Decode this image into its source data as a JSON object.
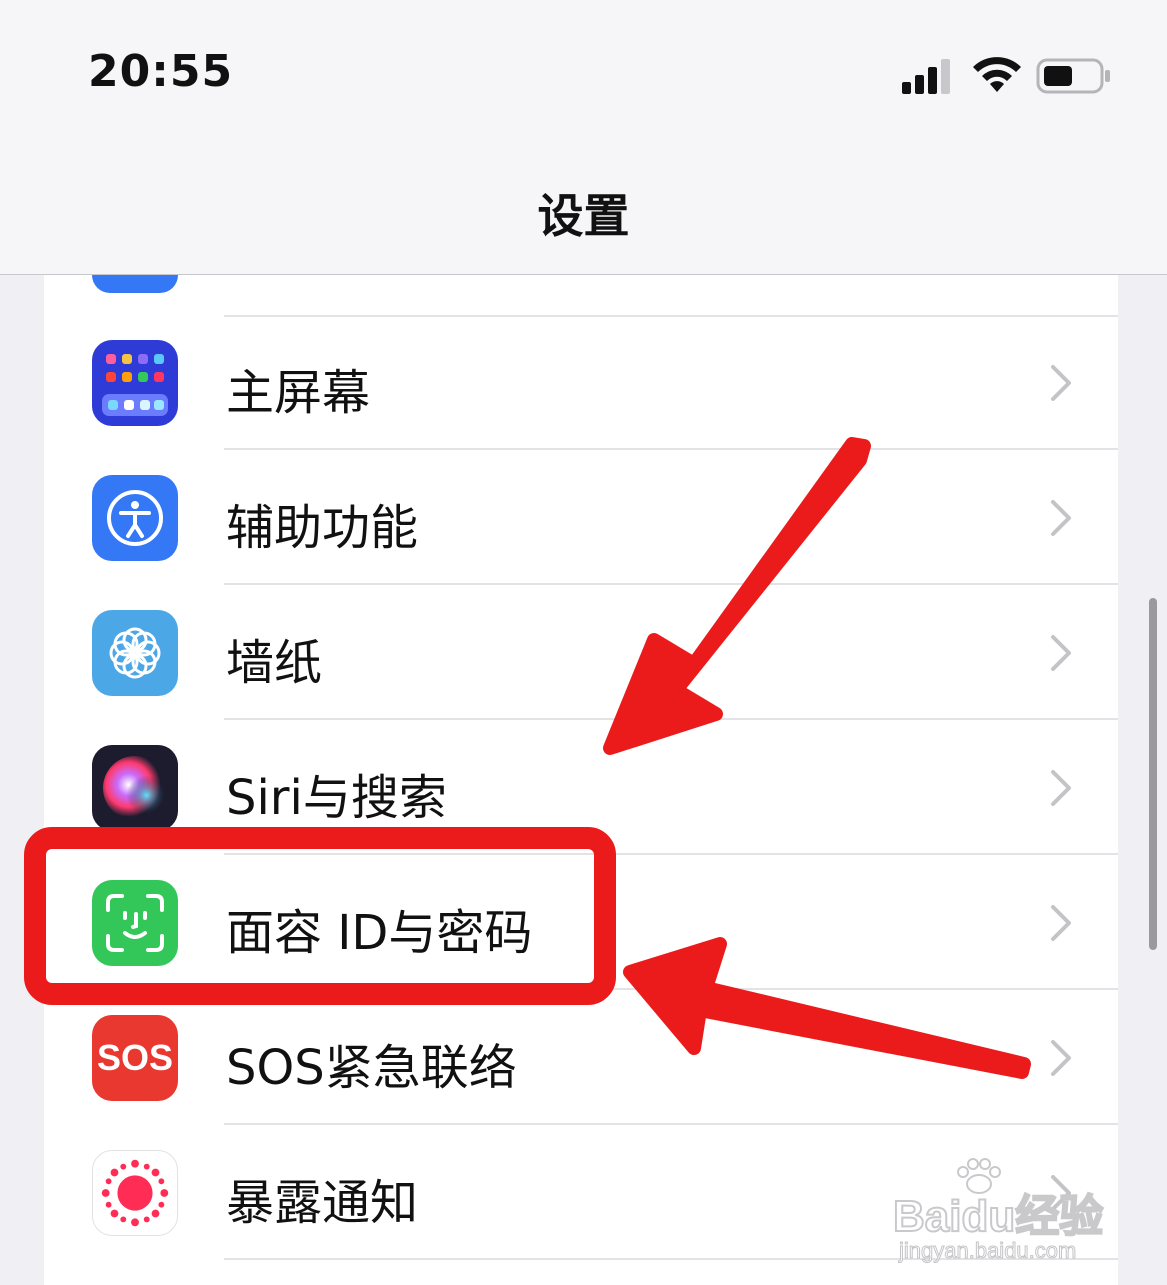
{
  "status_bar": {
    "time": "20:55",
    "signal_icon": "cellular-signal-icon",
    "wifi_icon": "wifi-icon",
    "battery_icon": "battery-icon"
  },
  "nav": {
    "title": "设置"
  },
  "rows": [
    {
      "label": "主屏幕",
      "icon": "home-screen-icon",
      "color": "#2e3bd6"
    },
    {
      "label": "辅助功能",
      "icon": "accessibility-icon",
      "color": "#3478f6"
    },
    {
      "label": "墙纸",
      "icon": "wallpaper-icon",
      "color": "#4ca7e6"
    },
    {
      "label": "Siri与搜索",
      "icon": "siri-icon",
      "color": "#1c1c2e"
    },
    {
      "label": "面容 ID与密码",
      "icon": "face-id-icon",
      "color": "#33c759"
    },
    {
      "label": "SOS紧急联络",
      "icon": "sos-icon",
      "color": "#e8382f",
      "icon_text": "SOS"
    },
    {
      "label": "暴露通知",
      "icon": "exposure-notification-icon",
      "color": "#ffffff"
    }
  ],
  "annotation": {
    "highlight_color": "#ec1b1b"
  },
  "watermark": {
    "brand": "Baidu经验",
    "url": "jingyan.baidu.com"
  }
}
